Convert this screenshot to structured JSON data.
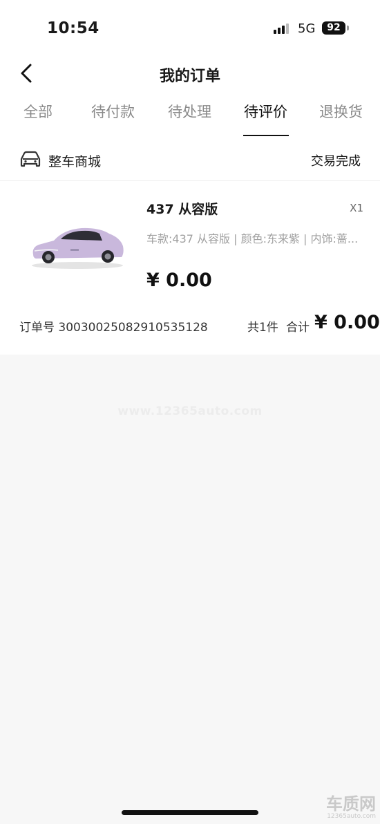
{
  "status_bar": {
    "time": "10:54",
    "network": "5G",
    "battery": "92"
  },
  "nav": {
    "title": "我的订单"
  },
  "tabs": [
    {
      "label": "全部"
    },
    {
      "label": "待付款"
    },
    {
      "label": "待处理"
    },
    {
      "label": "待评价",
      "active": true
    },
    {
      "label": "退换货"
    }
  ],
  "order": {
    "store_name": "整车商城",
    "status": "交易完成",
    "product": {
      "title": "437 从容版",
      "quantity": "X1",
      "spec": "车款:437 从容版 | 颜色:东来紫 | 内饰:蔷...",
      "price": "¥ 0.00"
    },
    "order_no": "订单号 3003002508291053512​8",
    "item_count": "共1件",
    "total_label": "合计",
    "total": "¥ 0.00"
  },
  "watermark": "www.12365auto.com",
  "corner_logo": {
    "name": "车质网",
    "url": "12365auto.com"
  }
}
